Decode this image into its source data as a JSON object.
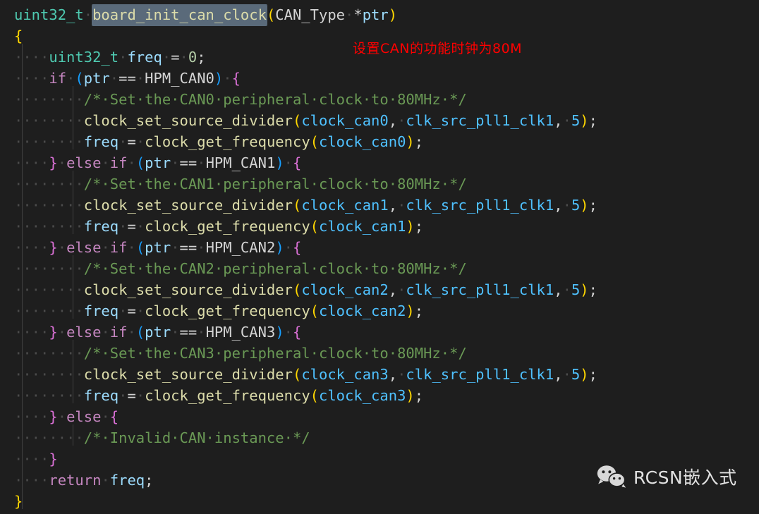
{
  "editor": {
    "theme": "dark-plus",
    "background_color": "#1e1e1e",
    "default_text_color": "#d4d4d4",
    "language": "c",
    "render_whitespace": true,
    "whitespace_glyph": "·",
    "highlighted_word": "board_init_can_clock",
    "highlight_color": "#5a6a7a",
    "lines": [
      {
        "n": 1,
        "text": "uint32_t board_init_can_clock(CAN_Type *ptr)"
      },
      {
        "n": 2,
        "text": "{"
      },
      {
        "n": 3,
        "text": "    uint32_t freq = 0;"
      },
      {
        "n": 4,
        "text": "    if (ptr == HPM_CAN0) {"
      },
      {
        "n": 5,
        "text": "        /* Set the CAN0 peripheral clock to 80MHz */"
      },
      {
        "n": 6,
        "text": "        clock_set_source_divider(clock_can0, clk_src_pll1_clk1, 5);"
      },
      {
        "n": 7,
        "text": "        freq = clock_get_frequency(clock_can0);"
      },
      {
        "n": 8,
        "text": "    } else if (ptr == HPM_CAN1) {"
      },
      {
        "n": 9,
        "text": "        /* Set the CAN1 peripheral clock to 80MHz */"
      },
      {
        "n": 10,
        "text": "        clock_set_source_divider(clock_can1, clk_src_pll1_clk1, 5);"
      },
      {
        "n": 11,
        "text": "        freq = clock_get_frequency(clock_can1);"
      },
      {
        "n": 12,
        "text": "    } else if (ptr == HPM_CAN2) {"
      },
      {
        "n": 13,
        "text": "        /* Set the CAN2 peripheral clock to 80MHz */"
      },
      {
        "n": 14,
        "text": "        clock_set_source_divider(clock_can2, clk_src_pll1_clk1, 5);"
      },
      {
        "n": 15,
        "text": "        freq = clock_get_frequency(clock_can2);"
      },
      {
        "n": 16,
        "text": "    } else if (ptr == HPM_CAN3) {"
      },
      {
        "n": 17,
        "text": "        /* Set the CAN3 peripheral clock to 80MHz */"
      },
      {
        "n": 18,
        "text": "        clock_set_source_divider(clock_can3, clk_src_pll1_clk1, 5);"
      },
      {
        "n": 19,
        "text": "        freq = clock_get_frequency(clock_can3);"
      },
      {
        "n": 20,
        "text": "    } else {"
      },
      {
        "n": 21,
        "text": "        /* Invalid CAN instance */"
      },
      {
        "n": 22,
        "text": "    }"
      },
      {
        "n": 23,
        "text": "    return freq;"
      },
      {
        "n": 24,
        "text": "}"
      }
    ],
    "tokens": {
      "return_type": "uint32_t",
      "function_name": "board_init_can_clock",
      "param_type": "CAN_Type",
      "param_name": "ptr",
      "local_var": "freq",
      "init_value": "0",
      "keyword_if": "if",
      "keyword_else": "else",
      "keyword_return": "return",
      "api_set_divider": "clock_set_source_divider",
      "api_get_frequency": "clock_get_frequency",
      "clock_source": "clk_src_pll1_clk1",
      "divider_value": "5",
      "instances": [
        "HPM_CAN0",
        "HPM_CAN1",
        "HPM_CAN2",
        "HPM_CAN3"
      ],
      "clock_names": [
        "clock_can0",
        "clock_can1",
        "clock_can2",
        "clock_can3"
      ],
      "comments": [
        "/* Set the CAN0 peripheral clock to 80MHz */",
        "/* Set the CAN1 peripheral clock to 80MHz */",
        "/* Set the CAN2 peripheral clock to 80MHz */",
        "/* Set the CAN3 peripheral clock to 80MHz */",
        "/* Invalid CAN instance */"
      ]
    }
  },
  "annotation": {
    "text": "设置CAN的功能时钟为80M",
    "color": "#ff0000"
  },
  "watermark": {
    "icon": "wechat-icon",
    "text": "RCSN嵌入式",
    "color": "#e2e2e2"
  }
}
